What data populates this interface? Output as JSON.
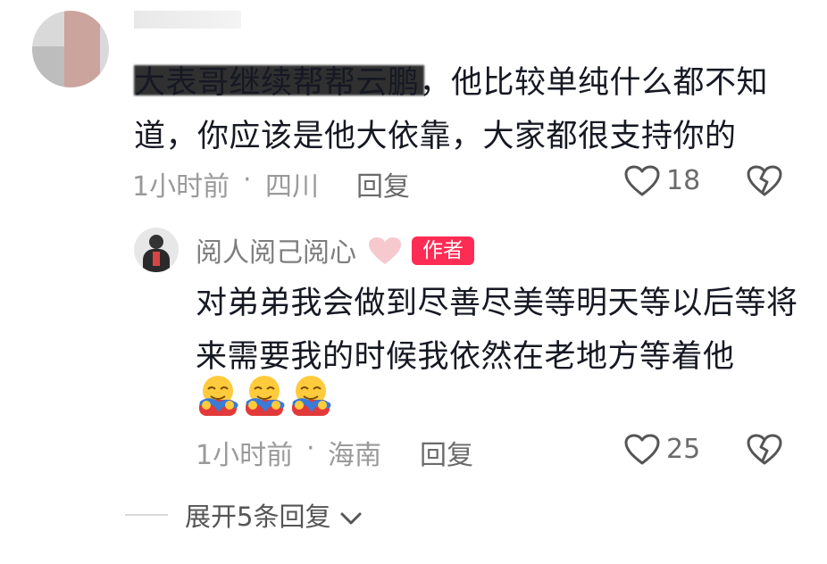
{
  "comment": {
    "text": "大表哥继续帮帮云鹏，他比较单纯什么都不知道，你应该是他大依靠，大家都很支持你的",
    "time": "1小时前",
    "separator": "·",
    "location": "四川",
    "reply_label": "回复",
    "likes": "18"
  },
  "reply": {
    "username": "阅人阅己阅心",
    "badge": "作者",
    "text": "对弟弟我会做到尽善尽美等明天等以后等将来需要我的时候我依然在老地方等着他",
    "emoji_count": 3,
    "time": "1小时前",
    "separator": "·",
    "location": "海南",
    "reply_label": "回复",
    "likes": "25"
  },
  "expand": {
    "label": "展开5条回复"
  },
  "colors": {
    "badge": "#fe2c55",
    "meta_text": "#9a9a9a",
    "heart_outline": "#555555"
  },
  "icons": [
    "heart-outline-icon",
    "broken-heart-icon",
    "hug-emoji-icon",
    "chevron-down-icon",
    "pink-heart-emoji-icon"
  ]
}
